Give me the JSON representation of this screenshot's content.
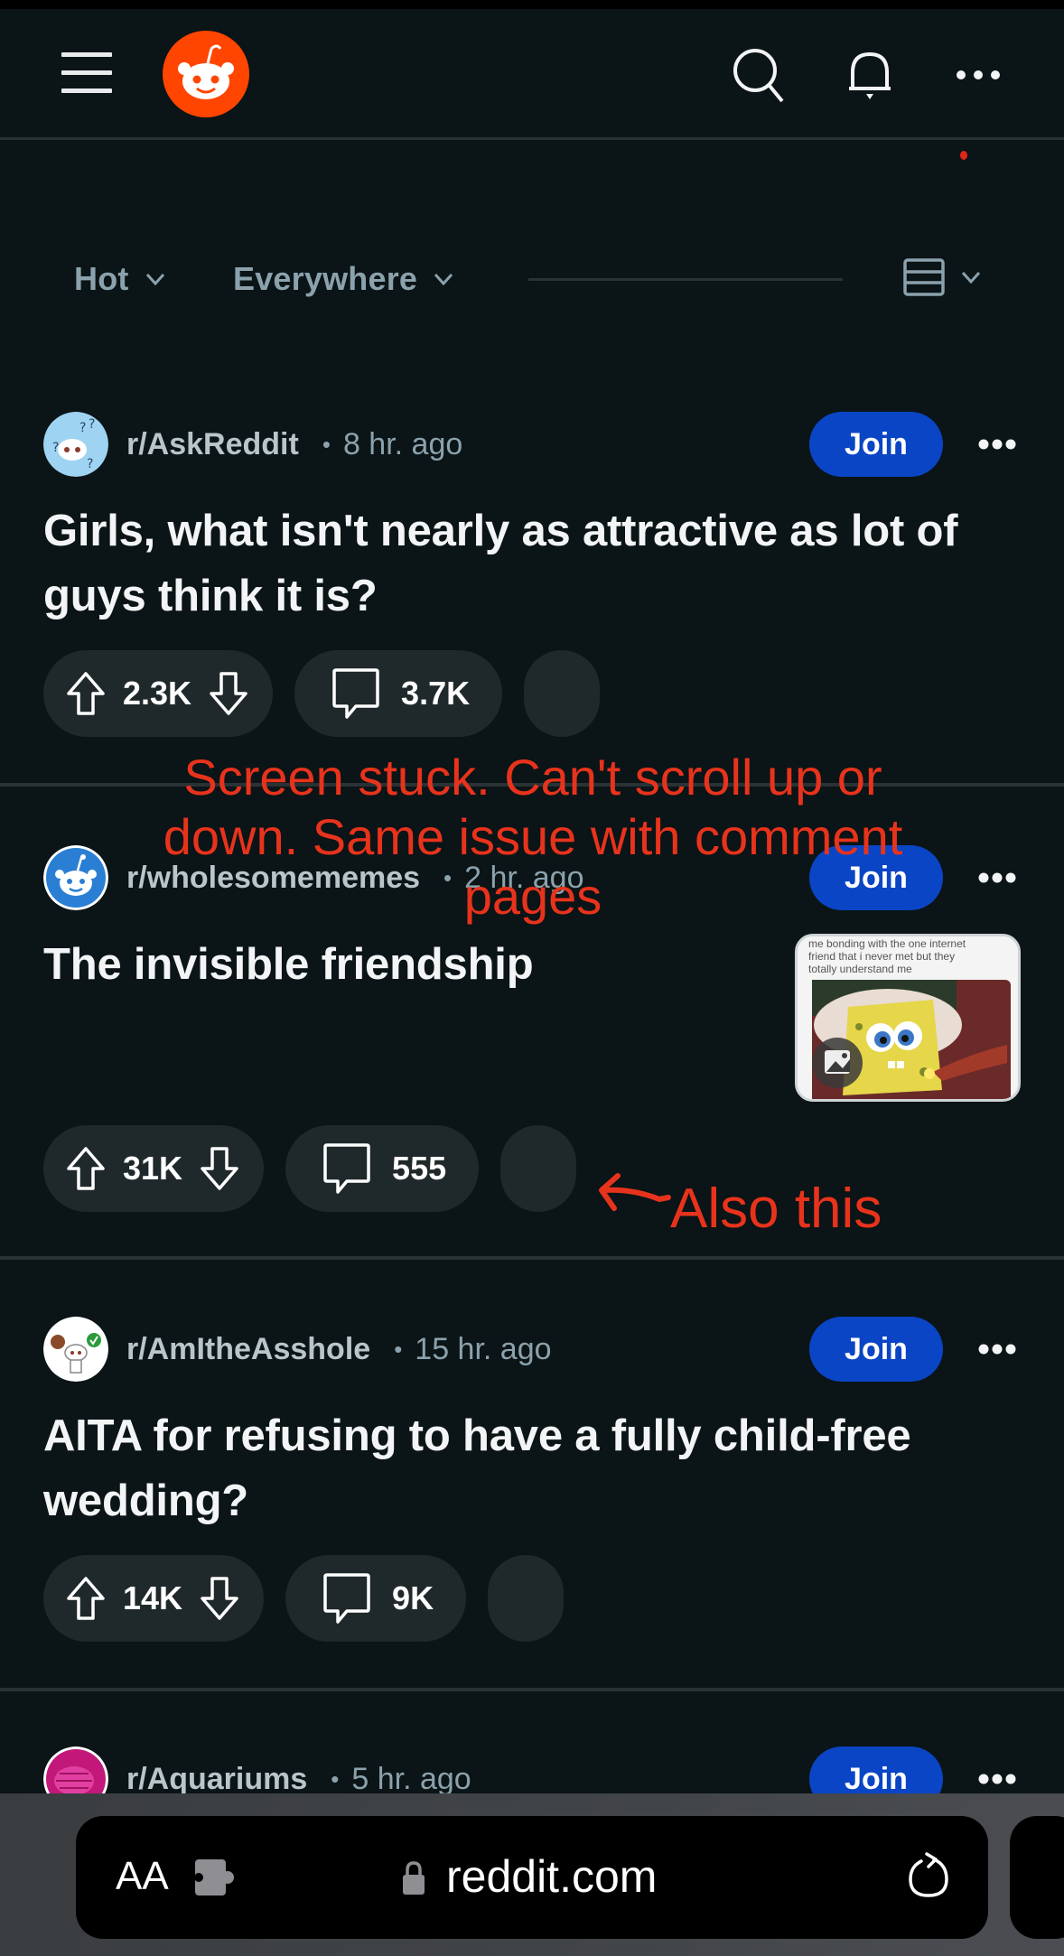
{
  "app": {
    "name": "Reddit",
    "brand_color": "#ff4500",
    "join_color": "#0a45c5",
    "background": "#0b1416"
  },
  "header": {
    "icons": [
      "menu-icon",
      "reddit-logo",
      "search-icon",
      "bell-icon",
      "more-icon"
    ]
  },
  "filters": {
    "sort_label": "Hot",
    "scope_label": "Everywhere",
    "layout_icon": "card-layout-icon"
  },
  "posts": [
    {
      "subreddit": "r/AskReddit",
      "separator": "•",
      "time": "8 hr. ago",
      "join_label": "Join",
      "title": "Girls, what isn't nearly as attractive as lot of guys think it is?",
      "upvotes": "2.3K",
      "comments": "3.7K",
      "has_thumbnail": false
    },
    {
      "subreddit": "r/wholesomememes",
      "separator": "•",
      "time": "2 hr. ago",
      "join_label": "Join",
      "title": "The invisible friendship",
      "upvotes": "31K",
      "comments": "555",
      "has_thumbnail": true,
      "thumbnail_caption": "me bonding with the one internet friend that i never met but they totally understand me"
    },
    {
      "subreddit": "r/AmItheAsshole",
      "separator": "•",
      "time": "15 hr. ago",
      "join_label": "Join",
      "title": "AITA for refusing to have a fully child-free wedding?",
      "upvotes": "14K",
      "comments": "9K",
      "has_thumbnail": false
    },
    {
      "subreddit": "r/Aquariums",
      "separator": "•",
      "time": "5 hr. ago",
      "join_label": "Join"
    }
  ],
  "annotations": {
    "main": "Screen stuck. Can't scroll up or down. Same issue with comment pages",
    "secondary": "Also this",
    "color": "#e8331c"
  },
  "browser": {
    "text_size_label": "AA",
    "url": "reddit.com"
  }
}
